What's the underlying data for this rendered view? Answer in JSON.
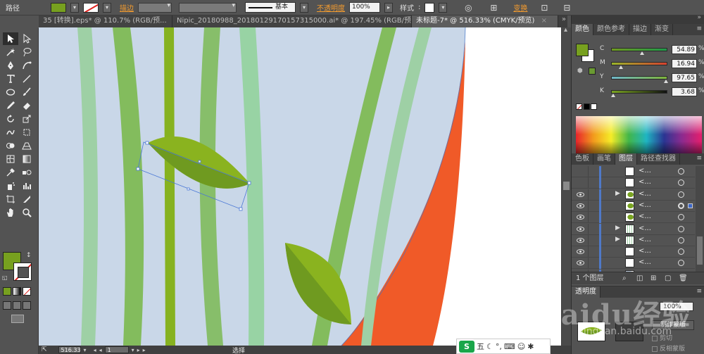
{
  "control_bar": {
    "object_type": "路径",
    "stroke_label": "描边",
    "stroke_style": "基本",
    "opacity_label": "不透明度",
    "opacity_value": "100%",
    "style_label": "样式",
    "transform_label": "变换",
    "fill_color": "#77a01f"
  },
  "tabs": [
    {
      "label": "35 [转换].eps* @ 110.7% (RGB/预..."
    },
    {
      "label": "Nipic_20180988_20180129170157315000.ai* @ 197.45% (RGB/预..."
    },
    {
      "label": "未标题-7* @ 516.33% (CMYK/预览)",
      "active": true
    }
  ],
  "status": {
    "zoom": "516.33",
    "page": "1",
    "tool_text": "选择"
  },
  "color_panel": {
    "tabs": [
      "颜色",
      "颜色参考",
      "描边",
      "渐变"
    ],
    "channels": [
      {
        "letter": "C",
        "value": "54.89",
        "unit": "%",
        "level": 0.55
      },
      {
        "letter": "M",
        "value": "16.94",
        "unit": "%",
        "level": 0.17
      },
      {
        "letter": "Y",
        "value": "97.65",
        "unit": "%",
        "level": 0.98
      },
      {
        "letter": "K",
        "value": "3.68",
        "unit": "%",
        "level": 0.04
      }
    ]
  },
  "layers_panel": {
    "tabs": [
      "色板",
      "画笔",
      "图层",
      "路径查找器"
    ],
    "rows": [
      {
        "name": "<...",
        "visible": false,
        "expand": "",
        "thumb": "white"
      },
      {
        "name": "<...",
        "visible": false,
        "expand": "",
        "thumb": "white"
      },
      {
        "name": "<...",
        "visible": true,
        "expand": "▶",
        "thumb": "leaf"
      },
      {
        "name": "<...",
        "visible": true,
        "expand": "",
        "thumb": "leaf",
        "selected": true
      },
      {
        "name": "<...",
        "visible": true,
        "expand": "",
        "thumb": "leaf"
      },
      {
        "name": "<...",
        "visible": true,
        "expand": "▶",
        "thumb": "stripes"
      },
      {
        "name": "<...",
        "visible": true,
        "expand": "▶",
        "thumb": "stripes"
      },
      {
        "name": "<...",
        "visible": true,
        "expand": "",
        "thumb": "white"
      },
      {
        "name": "<...",
        "visible": true,
        "expand": "",
        "thumb": "white"
      },
      {
        "name": "<...",
        "visible": true,
        "expand": "",
        "thumb": "bluewhite"
      }
    ],
    "footer": "1 个图层"
  },
  "transparency_panel": {
    "title": "透明度",
    "opacity": "100%",
    "make_mask": "制作蒙版",
    "clip": "剪切",
    "invert_mask": "反相蒙版"
  },
  "watermark": {
    "text": "Baidu经验",
    "url": "jingyan.baidu.com"
  },
  "ime": {
    "logo": "S",
    "mode": "五"
  }
}
